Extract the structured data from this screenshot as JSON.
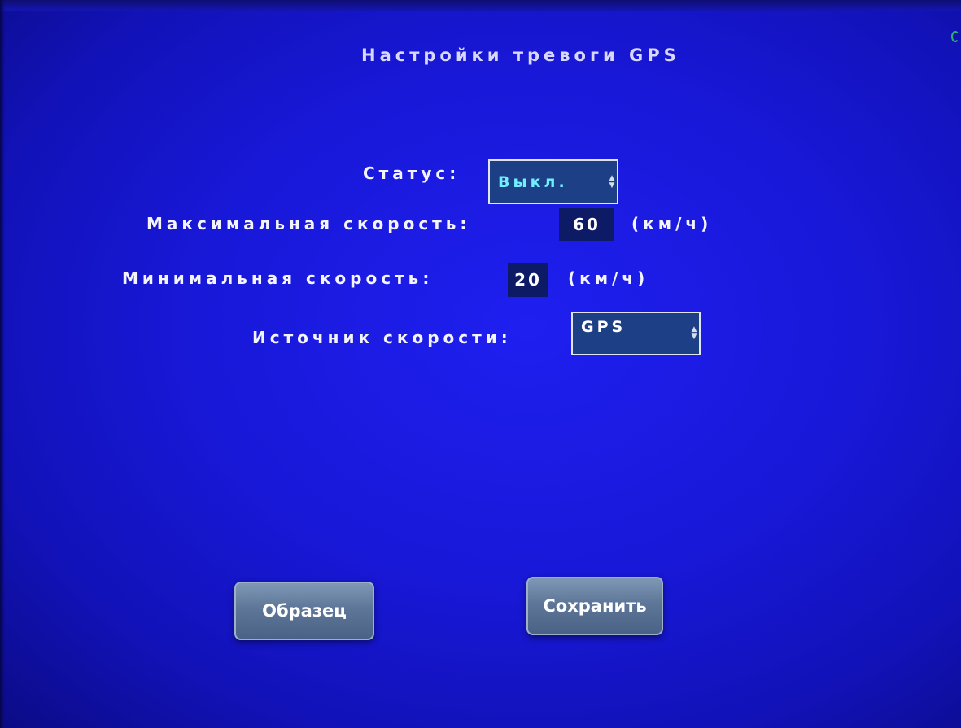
{
  "title": "Настройки тревоги GPS",
  "status": {
    "label": "Статус:",
    "value": "Выкл."
  },
  "max_speed": {
    "label": "Максимальная скорость:",
    "value": "60",
    "unit": "(км/ч)"
  },
  "min_speed": {
    "label": "Минимальная скорость:",
    "value": "20",
    "unit": "(км/ч)"
  },
  "speed_source": {
    "label": "Источник скорости:",
    "value": "GPS"
  },
  "buttons": {
    "sample": "Образец",
    "save": "Сохранить"
  },
  "colors": {
    "background": "#1818d8",
    "button": "#5e7798",
    "field": "#1c3f86"
  }
}
